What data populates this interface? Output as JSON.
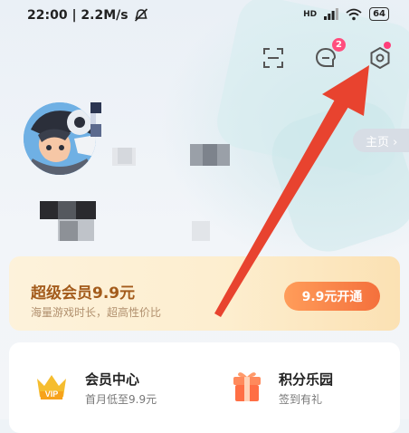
{
  "status_bar": {
    "time_speed": "22:00 | 2.2M/s",
    "signal": "HD",
    "battery": "64"
  },
  "profile": {
    "homepage_label": "主页 ›"
  },
  "header_icons": {
    "message_badge_count": "2"
  },
  "vip_banner": {
    "title": "超级会员9.9元",
    "subtitle": "海量游戏时长，超高性价比",
    "button_label": "9.9元开通"
  },
  "entries": [
    {
      "title": "会员中心",
      "subtitle": "首月低至9.9元",
      "icon": "vip-crown-icon"
    },
    {
      "title": "积分乐园",
      "subtitle": "签到有礼",
      "icon": "gift-box-icon"
    }
  ],
  "colors": {
    "accent_orange": "#f4703c",
    "badge_pink": "#ff4d7d",
    "arrow_red": "#e8432f"
  }
}
